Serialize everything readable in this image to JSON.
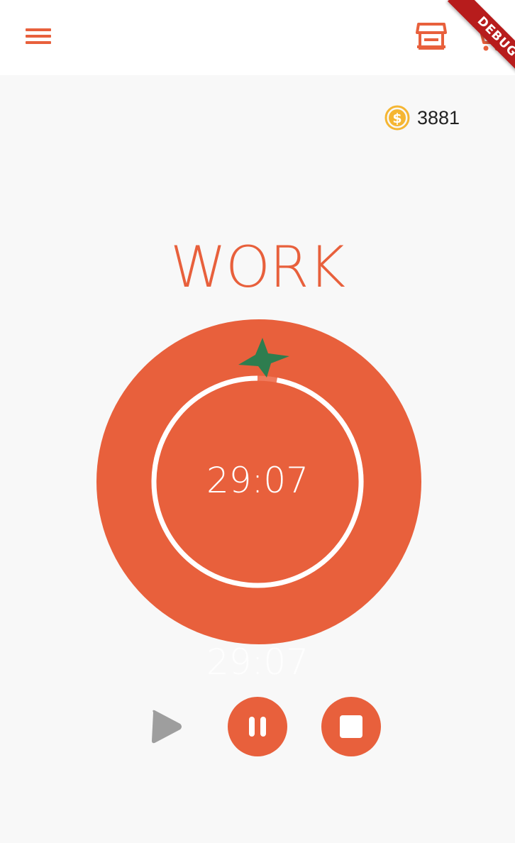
{
  "appbar": {
    "menu_icon": "menu-icon",
    "shop_icon": "store-icon",
    "cart_icon": "cart-icon",
    "accent_color": "#e8603c"
  },
  "debug_banner": {
    "label": "DEBUG",
    "color": "#b71c1c"
  },
  "coins": {
    "icon": "dollar-coin-icon",
    "count": "3881",
    "color": "#f5b633"
  },
  "timer": {
    "mode": "WORK",
    "time_remaining": "29:07",
    "time_reflection": "29:07",
    "progress_elapsed_fraction": 0.03,
    "tomato_color": "#e8603c",
    "stem_color": "#2e7d4f"
  },
  "controls": {
    "play_icon": "play-icon",
    "pause_icon": "pause-icon",
    "stop_icon": "stop-icon",
    "play_color": "#9e9e9e"
  }
}
